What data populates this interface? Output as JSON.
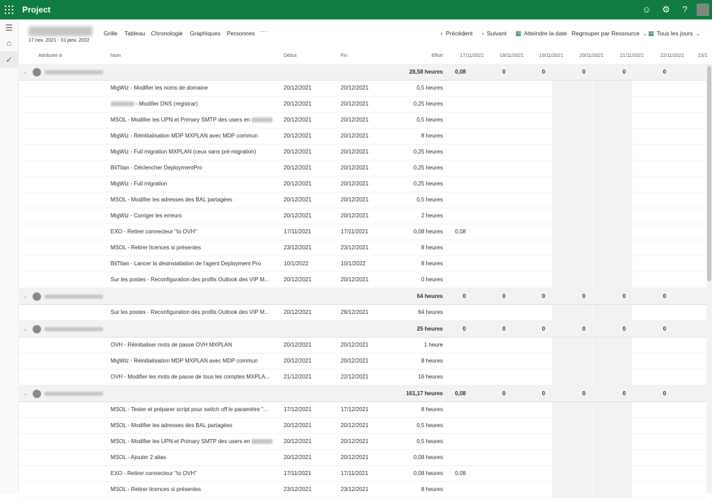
{
  "app": {
    "name": "Project"
  },
  "project": {
    "dates": "17 nov. 2021 - 31 janv. 2022"
  },
  "views": [
    "Grille",
    "Tableau",
    "Chronologie",
    "Graphiques",
    "Personnes"
  ],
  "toolbar": {
    "previous": "Précédent",
    "next": "Suivant",
    "goto_date": "Atteindre la date",
    "group_by": "Regrouper par Ressource",
    "all_days": "Tous les jours"
  },
  "columns": {
    "assigned": "Attribuée à",
    "name": "Nom",
    "start": "Début",
    "end": "Fin",
    "effort": "Effort",
    "days": [
      "17/11/2021",
      "18/11/2021",
      "19/11/2021",
      "20/11/2021",
      "21/11/2021",
      "22/11/2021",
      "23/1"
    ]
  },
  "groups": [
    {
      "effort": "28,58 heures",
      "days": [
        "0,08",
        "0",
        "0",
        "0",
        "0",
        "0"
      ],
      "tasks": [
        {
          "name": "MigWiz - Modifier les noms de domaine",
          "start": "20/12/2021",
          "end": "20/12/2021",
          "effort": "0,5 heures",
          "d1": ""
        },
        {
          "name": "- Modifier DNS (registrar)",
          "blur": "lead",
          "start": "20/12/2021",
          "end": "20/12/2021",
          "effort": "0,25 heures",
          "d1": ""
        },
        {
          "name": "MSOL - Modifier les UPN et Primary SMTP des users en",
          "blur": "trail",
          "start": "20/12/2021",
          "end": "20/12/2021",
          "effort": "0,5 heures",
          "d1": ""
        },
        {
          "name": "MigWiz - Réinitialisation MDP MXPLAN avec MDP commun",
          "start": "20/12/2021",
          "end": "20/12/2021",
          "effort": "8 heures",
          "d1": ""
        },
        {
          "name": "MigWiz - Full migration MXPLAN (ceux sans pré-migration)",
          "start": "20/12/2021",
          "end": "20/12/2021",
          "effort": "0,25 heures",
          "d1": ""
        },
        {
          "name": "BitTitan - Déclencher DeploymentPro",
          "start": "20/12/2021",
          "end": "20/12/2021",
          "effort": "0,25 heures",
          "d1": ""
        },
        {
          "name": "MigWiz - Full migration",
          "start": "20/12/2021",
          "end": "20/12/2021",
          "effort": "0,25 heures",
          "d1": ""
        },
        {
          "name": "MSOL - Modifier les adresses des BAL partagées",
          "start": "20/12/2021",
          "end": "20/12/2021",
          "effort": "0,5 heures",
          "d1": ""
        },
        {
          "name": "MigWiz - Corriger les erreurs",
          "start": "20/12/2021",
          "end": "20/12/2021",
          "effort": "2 heures",
          "d1": ""
        },
        {
          "name": "EXO - Retirer connecteur \"to OVH\"",
          "start": "17/11/2021",
          "end": "17/11/2021",
          "effort": "0,08 heures",
          "d1": "0,08"
        },
        {
          "name": "MSOL - Retirer licences si présentes",
          "start": "23/12/2021",
          "end": "23/12/2021",
          "effort": "8 heures",
          "d1": ""
        },
        {
          "name": "BitTitan - Lancer la désinstallation de l'agent Deployment Pro",
          "start": "10/1/2022",
          "end": "10/1/2022",
          "effort": "8 heures",
          "d1": ""
        },
        {
          "name": "Sur les postes - Reconfiguration des profils Outlook des VIP M...",
          "start": "20/12/2021",
          "end": "20/12/2021",
          "effort": "0 heures",
          "d1": ""
        }
      ]
    },
    {
      "effort": "64 heures",
      "days": [
        "0",
        "0",
        "0",
        "0",
        "0",
        "0"
      ],
      "tasks": [
        {
          "name": "Sur les postes - Reconfiguration des profils Outlook des VIP M...",
          "start": "20/12/2021",
          "end": "29/12/2021",
          "effort": "64 heures",
          "d1": ""
        }
      ]
    },
    {
      "effort": "25 heures",
      "days": [
        "0",
        "0",
        "0",
        "0",
        "0",
        "0"
      ],
      "tasks": [
        {
          "name": "OVH - Réinitialiser mots de passe OVH MXPLAN",
          "start": "20/12/2021",
          "end": "20/12/2021",
          "effort": "1 heure",
          "d1": ""
        },
        {
          "name": "MigWiz - Réinitialisation MDP MXPLAN avec MDP commun",
          "start": "20/12/2021",
          "end": "20/12/2021",
          "effort": "8 heures",
          "d1": ""
        },
        {
          "name": "OVH - Modifier les mots de passe de tous les comptes MXPLA...",
          "start": "21/12/2021",
          "end": "22/12/2021",
          "effort": "16 heures",
          "d1": ""
        }
      ]
    },
    {
      "effort": "161,17 heures",
      "days": [
        "0,08",
        "0",
        "0",
        "0",
        "0",
        "0"
      ],
      "tasks": [
        {
          "name": "MSOL - Tester et préparer script pour switch off le paramètre \"...",
          "start": "17/12/2021",
          "end": "17/12/2021",
          "effort": "8 heures",
          "d1": ""
        },
        {
          "name": "MSOL - Modifier les adresses des BAL partagées",
          "start": "20/12/2021",
          "end": "20/12/2021",
          "effort": "0,5 heures",
          "d1": ""
        },
        {
          "name": "MSOL - Modifier les UPN et Primary SMTP des users en",
          "blur": "trail",
          "start": "20/12/2021",
          "end": "20/12/2021",
          "effort": "0,5 heures",
          "d1": ""
        },
        {
          "name": "MSOL - Ajouter 2 alias",
          "start": "20/12/2021",
          "end": "20/12/2021",
          "effort": "0,08 heures",
          "d1": ""
        },
        {
          "name": "EXO - Retirer connecteur \"to OVH\"",
          "start": "17/11/2021",
          "end": "17/11/2021",
          "effort": "0,08 heures",
          "d1": "0,08"
        },
        {
          "name": "MSOL - Retirer licences si présentes",
          "start": "23/12/2021",
          "end": "23/12/2021",
          "effort": "8 heures",
          "d1": ""
        }
      ]
    }
  ],
  "icons": {
    "waffle": "waffle-icon",
    "smiley": "smiley-icon",
    "settings": "gear-icon",
    "help": "help-icon",
    "menu": "hamburger-icon",
    "home": "home-icon",
    "check": "check-icon",
    "prev": "chevron-left-icon",
    "next": "chevron-right-icon",
    "calendar": "calendar-icon"
  },
  "colors": {
    "brand": "#107c41",
    "group_row": "#f3f2f1",
    "weekend": "#f3f2f1"
  }
}
